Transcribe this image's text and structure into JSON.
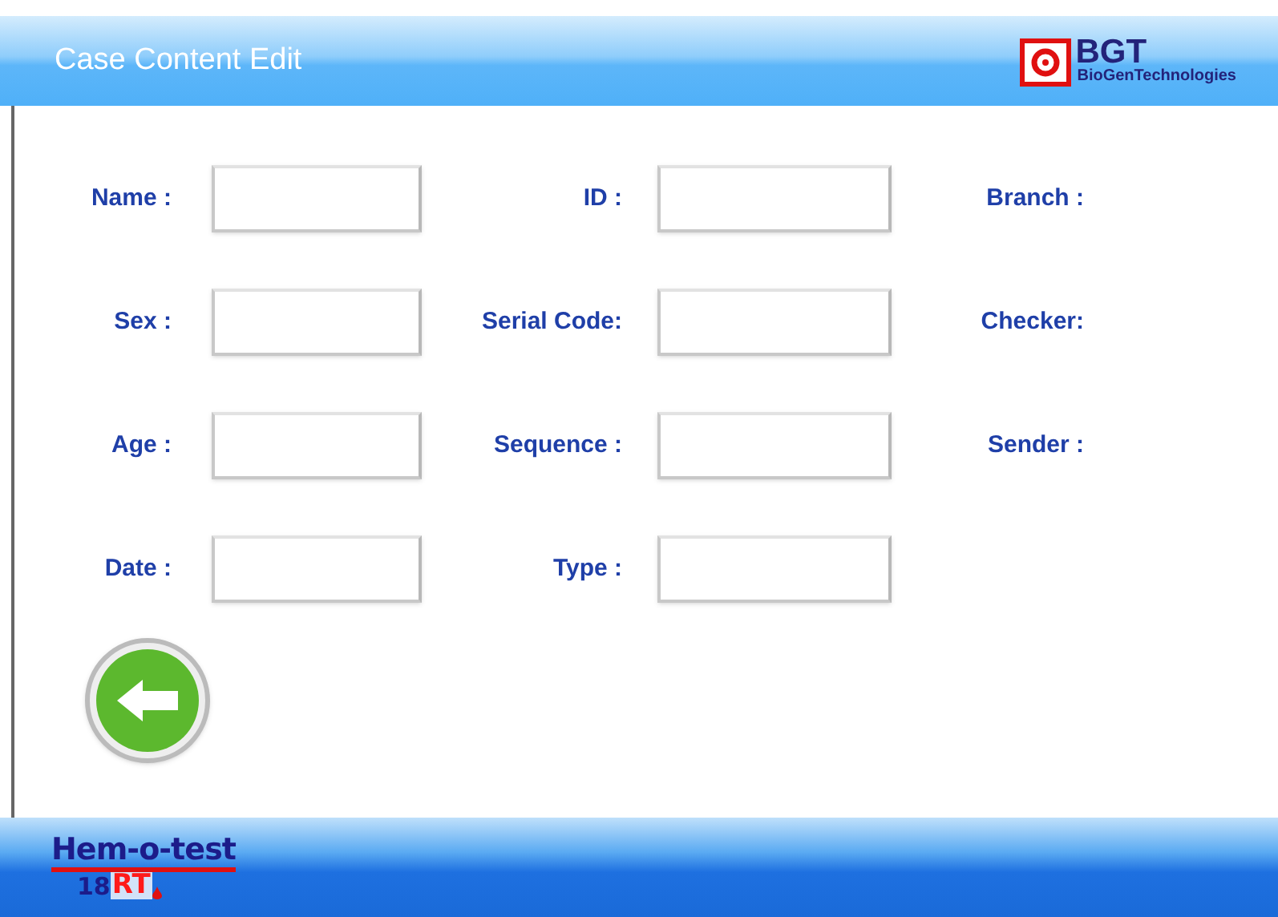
{
  "header": {
    "title": "Case Content Edit",
    "logo": {
      "mark": "BGT",
      "subtitle": "BioGenTechnologies"
    }
  },
  "form": {
    "rows": [
      {
        "fields": [
          {
            "label": "Name :"
          },
          {
            "label": "ID :"
          }
        ],
        "info_label": "Branch :"
      },
      {
        "fields": [
          {
            "label": "Sex :"
          },
          {
            "label": "Serial Code:"
          }
        ],
        "info_label": "Checker:"
      },
      {
        "fields": [
          {
            "label": "Age :"
          },
          {
            "label": "Sequence :"
          }
        ],
        "info_label": "Sender :"
      },
      {
        "fields": [
          {
            "label": "Date :"
          },
          {
            "label": "Type :"
          }
        ]
      }
    ]
  },
  "footer": {
    "logo_name": "Hem-o-test",
    "logo_number": "18",
    "logo_suffix": "RT"
  }
}
